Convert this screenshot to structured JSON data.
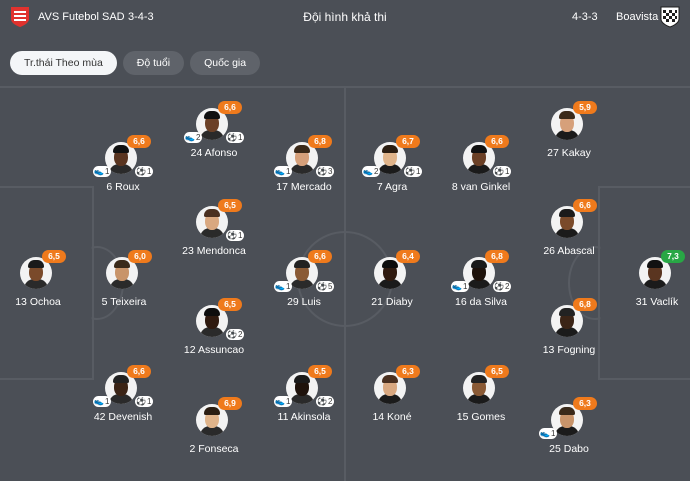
{
  "header": {
    "home_team": "AVS Futebol SAD",
    "home_formation": "3-4-3",
    "title": "Đội hình khả thi",
    "away_formation": "4-3-3",
    "away_team": "Boavista"
  },
  "tabs": [
    {
      "label": "Tr.thái Theo mùa",
      "active": true
    },
    {
      "label": "Độ tuổi",
      "active": false
    },
    {
      "label": "Quốc gia",
      "active": false
    }
  ],
  "colors": {
    "rating": "#ef7a1c",
    "rating_best": "#28a745",
    "home_logo": "#e0322e",
    "away_logo": "#1e1e1e"
  },
  "home_players": [
    {
      "name": "13 Ochoa",
      "rating": "6,5"
    },
    {
      "name": "42 Devenish",
      "rating": "6,6",
      "assists": "1",
      "goals": "1"
    },
    {
      "name": "5 Teixeira",
      "rating": "6,0"
    },
    {
      "name": "6 Roux",
      "rating": "6,6",
      "assists": "1",
      "goals": "1"
    },
    {
      "name": "2 Fonseca",
      "rating": "6,9"
    },
    {
      "name": "12 Assuncao",
      "rating": "6,5",
      "goals": "2"
    },
    {
      "name": "23 Mendonca",
      "rating": "6,5",
      "goals": "1"
    },
    {
      "name": "24 Afonso",
      "rating": "6,6",
      "assists": "2",
      "goals": "1"
    },
    {
      "name": "11 Akinsola",
      "rating": "6,5",
      "assists": "1",
      "goals": "2"
    },
    {
      "name": "29 Luis",
      "rating": "6,6",
      "assists": "1",
      "goals": "5"
    },
    {
      "name": "17 Mercado",
      "rating": "6,8",
      "assists": "1",
      "goals": "3"
    }
  ],
  "away_players": [
    {
      "name": "7 Agra",
      "rating": "6,7",
      "assists": "2",
      "goals": "1"
    },
    {
      "name": "21 Diaby",
      "rating": "6,4"
    },
    {
      "name": "14 Koné",
      "rating": "6,3"
    },
    {
      "name": "8 van Ginkel",
      "rating": "6,6",
      "goals": "1"
    },
    {
      "name": "16 da Silva",
      "rating": "6,8",
      "assists": "1",
      "goals": "2"
    },
    {
      "name": "15 Gomes",
      "rating": "6,5"
    },
    {
      "name": "27 Kakay",
      "rating": "5,9"
    },
    {
      "name": "26 Abascal",
      "rating": "6,6"
    },
    {
      "name": "13 Fogning",
      "rating": "6,8"
    },
    {
      "name": "25 Dabo",
      "rating": "6,3",
      "assists": "1"
    },
    {
      "name": "31 Vaclík",
      "rating": "7,3",
      "best": true
    }
  ]
}
